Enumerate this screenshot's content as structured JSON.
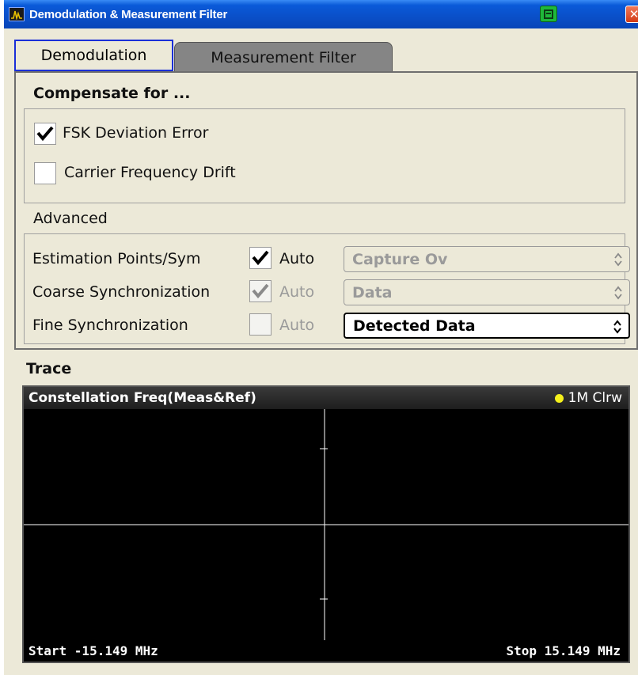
{
  "window": {
    "title": "Demodulation & Measurement Filter"
  },
  "tabs": [
    {
      "label": "Demodulation",
      "active": true
    },
    {
      "label": "Measurement Filter",
      "active": false
    }
  ],
  "compensate": {
    "title": "Compensate for ...",
    "items": [
      {
        "label": "FSK Deviation Error",
        "checked": true
      },
      {
        "label": "Carrier Frequency Drift",
        "checked": false
      }
    ]
  },
  "advanced": {
    "title": "Advanced",
    "rows": [
      {
        "label": "Estimation Points/Sym",
        "auto_label": "Auto",
        "auto_checked": true,
        "auto_enabled": true,
        "value": "Capture Ov",
        "value_enabled": false
      },
      {
        "label": "Coarse Synchronization",
        "auto_label": "Auto",
        "auto_checked": true,
        "auto_enabled": false,
        "value": "Data",
        "value_enabled": false
      },
      {
        "label": "Fine Synchronization",
        "auto_label": "Auto",
        "auto_checked": false,
        "auto_enabled": false,
        "value": "Detected Data",
        "value_enabled": true
      }
    ]
  },
  "trace": {
    "title": "Trace",
    "plot_title": "Constellation Freq(Meas&Ref)",
    "trace_label": "1M Clrw",
    "trace_color": "#f4f01c",
    "start_label": "Start -15.149 MHz",
    "stop_label": "Stop 15.149 MHz"
  },
  "colors": {
    "titlebar": "#0a4fc8",
    "active_tab_border": "#1a2fd8",
    "panel_bg": "#ece9d8",
    "plot_bg": "#000000",
    "grid": "#ffffff"
  }
}
